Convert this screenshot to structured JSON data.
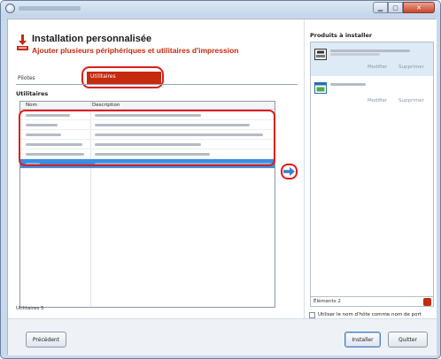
{
  "window": {
    "title": ""
  },
  "header": {
    "title": "Installation personnalisée",
    "subtitle": "Ajouter plusieurs périphériques et utilitaires d'impression"
  },
  "tabs": [
    {
      "label": "Pilotes",
      "active": false
    },
    {
      "label": "Utilitaires",
      "active": true
    }
  ],
  "utilities": {
    "section_title": "Utilitaires",
    "columns": [
      "Nom",
      "Description"
    ],
    "rows_visible": 6,
    "selected_row": 5,
    "count_label": "Utilitaires 5"
  },
  "products": {
    "title": "Produits à installer",
    "items": [
      {
        "modify_label": "Modifier",
        "delete_label": "Supprimer",
        "icon": "printer-icon"
      },
      {
        "modify_label": "Modifier",
        "delete_label": "Supprimer",
        "icon": "utility-window-icon"
      }
    ],
    "count_label": "Éléments 2"
  },
  "options": {
    "use_hostname_label": "Utiliser le nom d'hôte comme nom de port",
    "use_hostname_checked": false
  },
  "buttons": {
    "previous": "Précédent",
    "install": "Installer",
    "quit": "Quitter"
  },
  "colors": {
    "accent_red": "#c62a0f",
    "selection_blue": "#3b8de0",
    "annotation_red": "#e01c1c"
  }
}
